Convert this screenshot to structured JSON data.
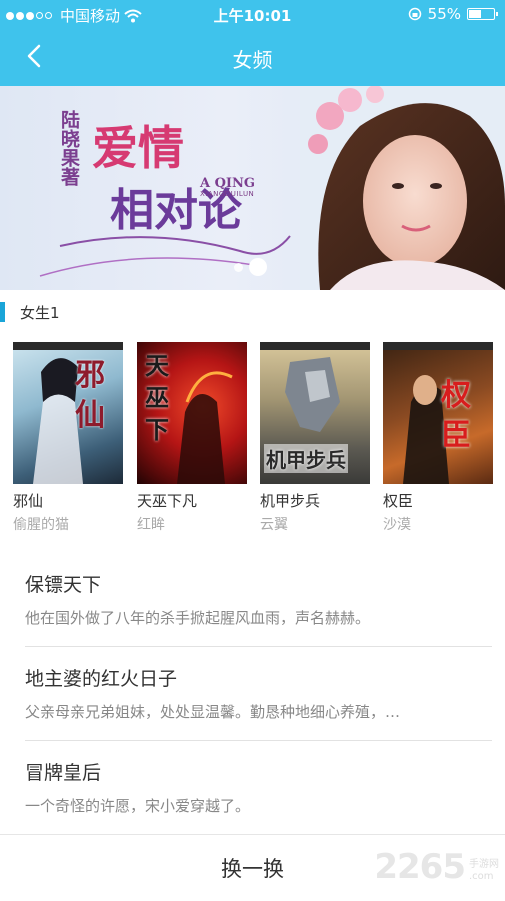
{
  "statusbar": {
    "carrier": "中国移动",
    "time": "上午10:01",
    "battery_text": "55%",
    "battery_level": 0.55
  },
  "navbar": {
    "title": "女频"
  },
  "banner": {
    "title_line1": "爱情",
    "title_line2": "相对论",
    "author": "陆晓果著",
    "roman": "A QING",
    "roman2": "XIANGDUILUN",
    "pager_total": 2,
    "pager_active": 2
  },
  "section": {
    "label": "女生1"
  },
  "books": [
    {
      "name": "邪仙",
      "author": "偷腥的猫",
      "cover_text": "邪仙"
    },
    {
      "name": "天巫下凡",
      "author": "红眸",
      "cover_text": "天巫下"
    },
    {
      "name": "机甲步兵",
      "author": "云翼",
      "cover_text": "机甲步兵"
    },
    {
      "name": "权臣",
      "author": "沙漠",
      "cover_text": "权臣"
    }
  ],
  "list": [
    {
      "title": "保镖天下",
      "desc": "他在国外做了八年的杀手掀起腥风血雨，声名赫赫。"
    },
    {
      "title": "地主婆的红火日子",
      "desc": "父亲母亲兄弟姐妹，处处显温馨。勤恳种地细心养殖，…"
    },
    {
      "title": "冒牌皇后",
      "desc": "一个奇怪的许愿，宋小爱穿越了。"
    }
  ],
  "footer": {
    "refresh_label": "换一换"
  },
  "watermark": {
    "number": "2265",
    "cn": "手游网",
    "dot_com": ".com"
  },
  "colors": {
    "accent": "#3fc3ec",
    "section_bar": "#1aa5d8"
  }
}
